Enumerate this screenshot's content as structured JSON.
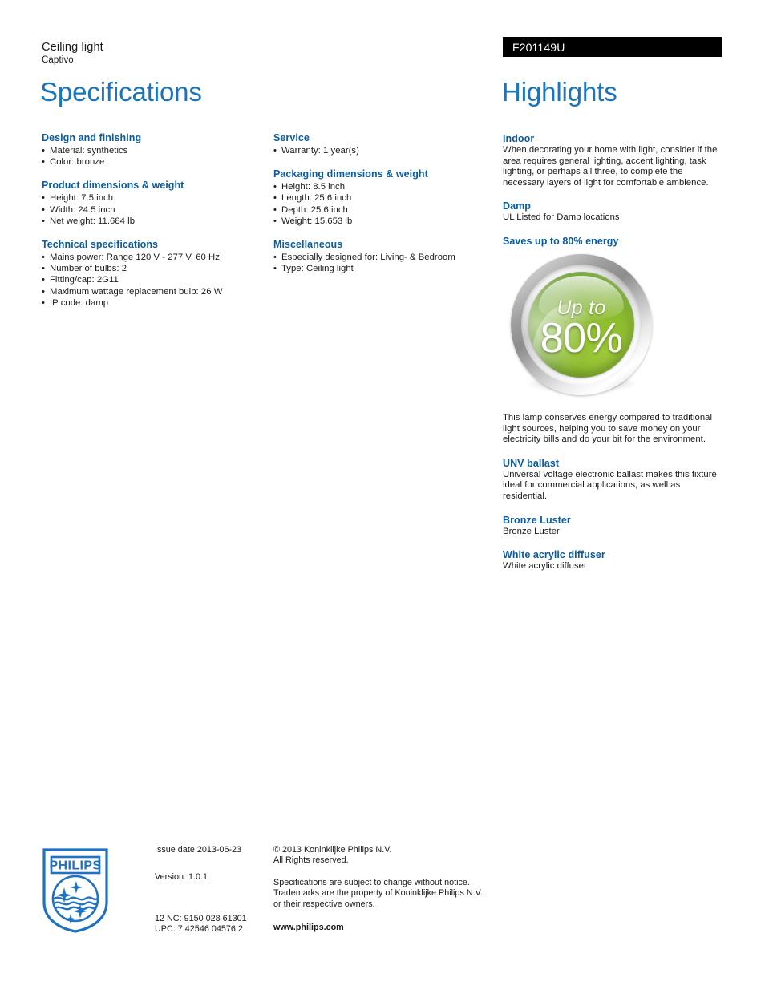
{
  "header": {
    "product_type": "Ceiling light",
    "product_name": "Captivo",
    "model_number": "F201149U"
  },
  "titles": {
    "specifications": "Specifications",
    "highlights": "Highlights"
  },
  "specifications": {
    "column1": [
      {
        "title": "Design and finishing",
        "items": [
          "Material: synthetics",
          "Color: bronze"
        ]
      },
      {
        "title": "Product dimensions & weight",
        "items": [
          "Height: 7.5 inch",
          "Width: 24.5 inch",
          "Net weight: 11.684 lb"
        ]
      },
      {
        "title": "Technical specifications",
        "items": [
          "Mains power: Range 120 V - 277 V, 60 Hz",
          "Number of bulbs: 2",
          "Fitting/cap: 2G11",
          "Maximum wattage replacement bulb: 26 W",
          "IP code: damp"
        ]
      }
    ],
    "column2": [
      {
        "title": "Service",
        "items": [
          "Warranty: 1 year(s)"
        ]
      },
      {
        "title": "Packaging dimensions & weight",
        "items": [
          "Height: 8.5 inch",
          "Length: 25.6 inch",
          "Depth: 25.6 inch",
          "Weight: 15.653 lb"
        ]
      },
      {
        "title": "Miscellaneous",
        "items": [
          "Especially designed for: Living- & Bedroom",
          "Type: Ceiling light"
        ]
      }
    ]
  },
  "highlights": [
    {
      "title": "Indoor",
      "body": "When decorating your home with light, consider if the area requires general lighting, accent lighting, task lighting, or perhaps all three, to complete the necessary layers of light for comfortable ambience."
    },
    {
      "title": "Damp",
      "body": "UL Listed for Damp locations"
    },
    {
      "title": "Saves up to 80% energy",
      "body": "This lamp conserves energy compared to traditional light sources, helping you to save money on your electricity bills and do your bit for the environment."
    },
    {
      "title": "UNV ballast",
      "body": "Universal voltage electronic ballast makes this fixture ideal for commercial applications, as well as residential."
    },
    {
      "title": "Bronze Luster",
      "body": "Bronze Luster"
    },
    {
      "title": "White acrylic diffuser",
      "body": "White acrylic diffuser"
    }
  ],
  "energy_badge": {
    "label_top": "Up to",
    "label_value": "80%"
  },
  "footer": {
    "issue_date": "Issue date 2013-06-23",
    "version": "Version: 1.0.1",
    "nc_code": "12 NC: 9150 028 61301",
    "upc_code": "UPC: 7 42546 04576 2",
    "copyright_line1": "© 2013 Koninklijke Philips N.V.",
    "copyright_line2": "All Rights reserved.",
    "disclaimer_line1": "Specifications are subject to change without notice.",
    "disclaimer_line2": "Trademarks are the property of Koninklijke Philips N.V.",
    "disclaimer_line3": "or their respective owners.",
    "website": "www.philips.com",
    "logo_text": "PHILIPS"
  },
  "colors": {
    "title_blue": "#1a76bc",
    "heading_blue": "#0b5c9e",
    "model_bar_bg": "#000000",
    "badge_green": "#8cbb2e",
    "logo_blue": "#1e72bf"
  }
}
